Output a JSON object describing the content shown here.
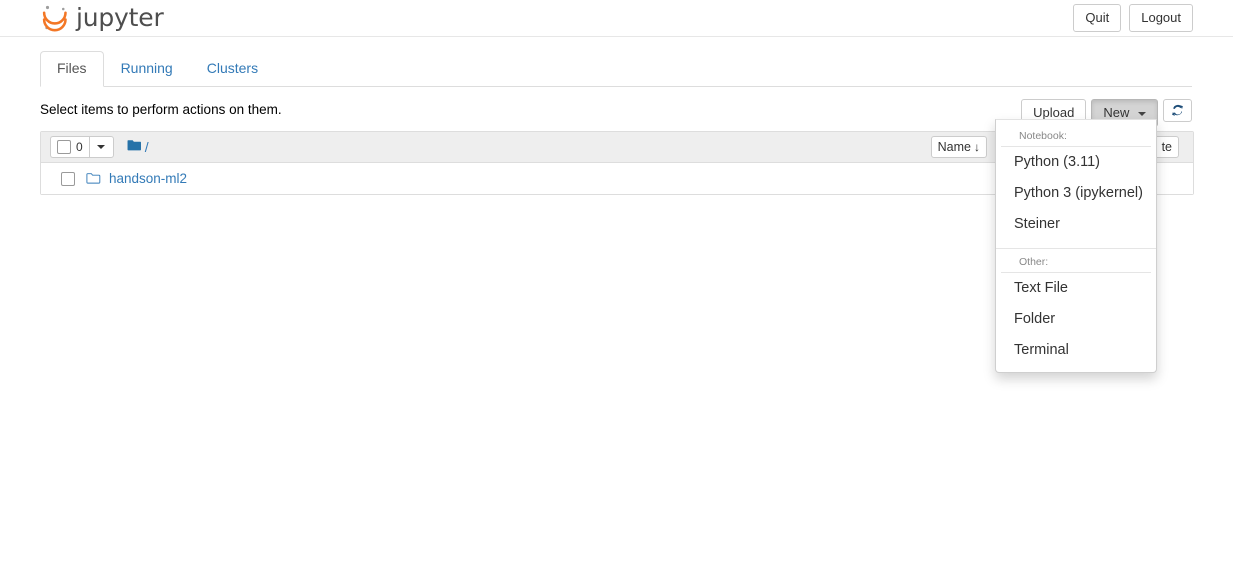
{
  "header": {
    "logo_text": "jupyter",
    "logo_icon": "jupyter-logo-icon",
    "quit_label": "Quit",
    "logout_label": "Logout"
  },
  "tabs": [
    {
      "label": "Files",
      "active": true
    },
    {
      "label": "Running",
      "active": false
    },
    {
      "label": "Clusters",
      "active": false
    }
  ],
  "toolbar": {
    "message": "Select items to perform actions on them.",
    "upload_label": "Upload",
    "new_label": "New",
    "refresh_icon": "refresh-icon"
  },
  "new_menu": {
    "notebook_header": "Notebook:",
    "notebook_items": [
      "Python (3.11)",
      "Python 3 (ipykernel)",
      "Steiner"
    ],
    "other_header": "Other:",
    "other_items": [
      "Text File",
      "Folder",
      "Terminal"
    ]
  },
  "filelist": {
    "selected_count": "0",
    "breadcrumb_root_icon": "folder-filled-icon",
    "breadcrumb_separator": "/",
    "sort_name_label": "Name",
    "sort_name_arrow": "↓",
    "sort_date_label": "te",
    "rows": [
      {
        "name": "handson-ml2",
        "icon": "folder-outline-icon"
      }
    ]
  },
  "colors": {
    "link": "#337ab7",
    "logo_orange": "#f37726",
    "logo_gray": "#9e9e9e",
    "header_bg": "#eeeeee"
  }
}
